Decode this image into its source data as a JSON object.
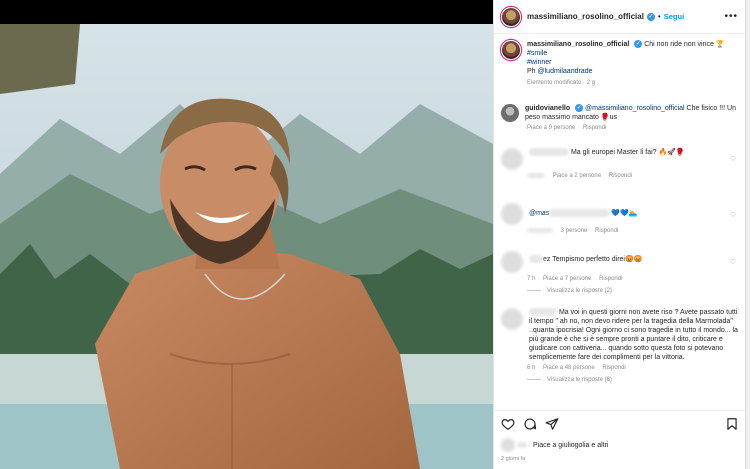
{
  "post": {
    "username": "massimiliano_rosolino_official",
    "follow_label": "Segui",
    "more_label": "•••",
    "caption_text": "Chi non ride non vince 🏆",
    "hashtag_1": "#smile",
    "hashtag_2": "#winner",
    "photo_prefix": "Ph ",
    "photo_credit": "@ludmilaandrade",
    "caption_meta": "Elemento modificato · 2 g"
  },
  "comments": [
    {
      "username": "guidovianello",
      "mention": "@massimiliano_rosolino_official",
      "text": " Che fisico !!! Un peso massimo mancato 🥊",
      "tail": "us",
      "likes": "Piace a 9 persone",
      "reply": "Rispondi"
    },
    {
      "text": "Ma gli europei Master li fai? 🔥🚀🥊",
      "likes": "Piace a 2 persone",
      "reply": "Rispondi"
    },
    {
      "prefix": "@mas",
      "text": "💙💙🏊",
      "likes": "3 persone",
      "reply": "Rispondi"
    },
    {
      "prefix": "ez",
      "text": " Tempismo perfetto direi😡😡",
      "age": "7 h",
      "likes": "Piace a 7 persone",
      "reply": "Rispondi",
      "view_replies": "Visualizza le risposte (2)"
    },
    {
      "text": "Ma voi in questi giorni non avete riso ? Avete passato tutti il tempo \" ah no, non devo ridere per la tragedia della Marmolada\" ..quanta ipocrisia! Ogni giorno ci sono tragedie in tutto il mondo... la più grande è che si è sempre pronti a puntare il dito, criticare e giudicare con cattiveria... quando sotto questa foto si potevano semplicemente fare dei complimenti per la vittoria.",
      "age": "6 h",
      "likes": "Piace a 48 persone",
      "reply": "Rispondi",
      "view_replies": "Visualizza le risposte (8)"
    }
  ],
  "footer": {
    "likes_text": "Piace a giuliogolia e altri",
    "date": "2 giorni fa"
  },
  "icons": [
    "heart-icon",
    "comment-icon",
    "share-icon",
    "bookmark-icon",
    "verified-icon",
    "more-icon"
  ],
  "colors": {
    "link": "#00376b",
    "follow": "#0095f6",
    "verified": "#3897f0"
  }
}
